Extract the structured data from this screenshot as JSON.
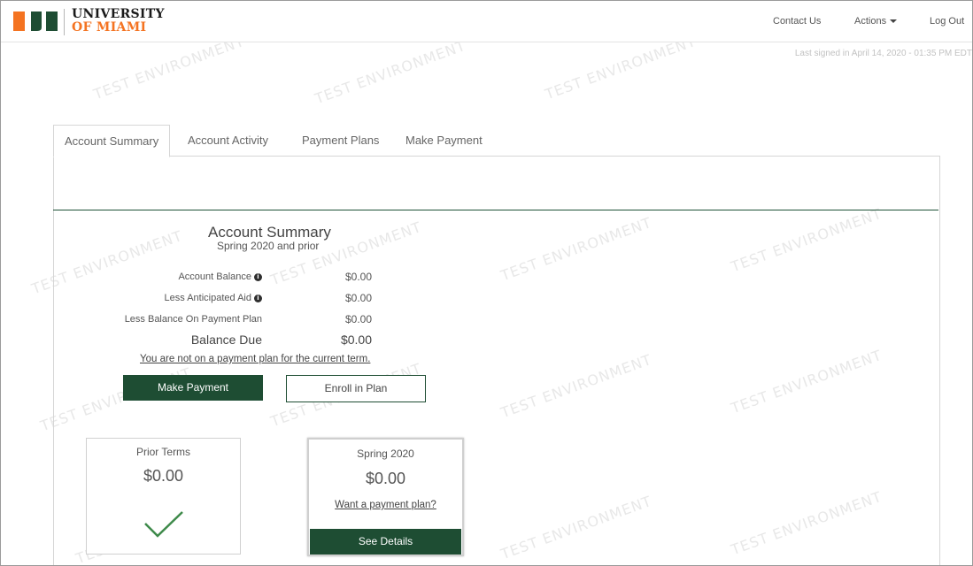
{
  "header": {
    "logo_line1": "UNIVERSITY",
    "logo_line2": "OF MIAMI",
    "nav": {
      "contact": "Contact Us",
      "actions": "Actions",
      "logout": "Log Out"
    },
    "last_signed": "Last signed in April 14, 2020 - 01:35 PM EDT"
  },
  "watermark": "TEST ENVIRONMENT",
  "tabs": [
    "Account Summary",
    "Account Activity",
    "Payment Plans",
    "Make Payment"
  ],
  "summary": {
    "title": "Account Summary",
    "subtitle": "Spring 2020 and prior",
    "rows": [
      {
        "label": "Account Balance",
        "value": "$0.00"
      },
      {
        "label": "Less Anticipated Aid",
        "value": "$0.00"
      },
      {
        "label": "Less Balance On Payment Plan",
        "value": "$0.00"
      },
      {
        "label": "Balance Due",
        "value": "$0.00"
      }
    ],
    "plan_notice": "You are not on a payment plan for the current term.",
    "make_payment_label": "Make Payment",
    "enroll_label": "Enroll in Plan"
  },
  "cards": {
    "prior": {
      "title": "Prior Terms",
      "amount": "$0.00"
    },
    "spring": {
      "title": "Spring 2020",
      "amount": "$0.00",
      "link": "Want a payment plan?",
      "button": "See Details"
    }
  },
  "colors": {
    "brand_green": "#1e4d33",
    "brand_orange": "#f47321",
    "check_green": "#3e8a4a"
  }
}
